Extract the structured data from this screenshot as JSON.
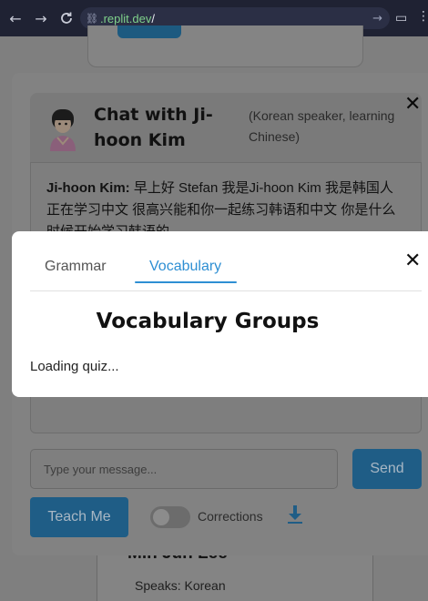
{
  "browser": {
    "url_host": ".replit.dev",
    "url_path": "/",
    "back_icon": "arrow-left",
    "forward_icon": "arrow-right",
    "reload_icon": "reload"
  },
  "background": {
    "card_name": "Min Jun Lee",
    "card_speaks": "Speaks: Korean"
  },
  "chat": {
    "title": "Chat with Ji-hoon Kim",
    "subtitle": "(Korean speaker, learning Chinese)",
    "close": "✕",
    "message_sender": "Ji-hoon Kim:",
    "message_text": " 早上好 Stefan 我是Ji-hoon Kim 我是韩国人 正在学习中文 很高兴能和你一起练习韩语和中文 你是什么时候开始学习韩语的",
    "input_placeholder": "Type your message...",
    "send_label": "Send",
    "teach_label": "Teach Me",
    "corrections_label": "Corrections",
    "corrections_enabled": false
  },
  "vocab_modal": {
    "tabs": [
      {
        "label": "Grammar",
        "active": false
      },
      {
        "label": "Vocabulary",
        "active": true
      }
    ],
    "close": "✕",
    "title": "Vocabulary Groups",
    "status": "Loading quiz..."
  },
  "colors": {
    "accent": "#2e8fd3",
    "browser_bar": "#1f2233",
    "url_green": "#7fd18b"
  }
}
